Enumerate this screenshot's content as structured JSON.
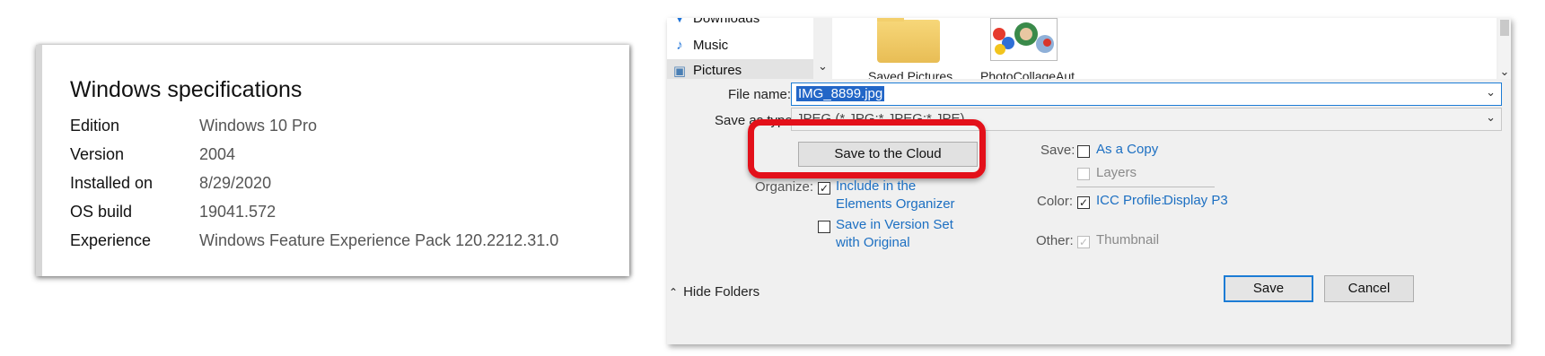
{
  "specs": {
    "title": "Windows specifications",
    "rows": [
      {
        "key": "Edition",
        "value": "Windows 10 Pro"
      },
      {
        "key": "Version",
        "value": "2004"
      },
      {
        "key": "Installed on",
        "value": "8/29/2020"
      },
      {
        "key": "OS build",
        "value": "19041.572"
      },
      {
        "key": "Experience",
        "value": "Windows Feature Experience Pack 120.2212.31.0"
      }
    ]
  },
  "dialog": {
    "nav": {
      "items": [
        {
          "label": "Downloads",
          "icon": "download-icon"
        },
        {
          "label": "Music",
          "icon": "music-note-icon"
        },
        {
          "label": "Pictures",
          "icon": "pictures-icon"
        }
      ]
    },
    "files": [
      {
        "label": "Saved Pictures",
        "icon": "folder-icon"
      },
      {
        "label": "PhotoCollageAut",
        "icon": "image-thumbnail-icon"
      }
    ],
    "file_name_label": "File name:",
    "file_name_value": "IMG_8899.jpg",
    "save_as_type_label": "Save as type:",
    "save_as_type_value": "JPEG (*.JPG;*.JPEG;*.JPE)",
    "cloud_button": "Save to the Cloud",
    "organize_label": "Organize:",
    "include_organizer_line1": "Include in the",
    "include_organizer_line2": "Elements Organizer",
    "version_set_line1": "Save in Version Set",
    "version_set_line2": "with Original",
    "save_label": "Save:",
    "as_copy": "As a Copy",
    "layers": "Layers",
    "color_label": "Color:",
    "icc_profile": "ICC Profile:",
    "icc_value": "Display P3",
    "other_label": "Other:",
    "thumbnail": "Thumbnail",
    "hide_folders": "Hide Folders",
    "save_button": "Save",
    "cancel_button": "Cancel",
    "highlight_color": "#e3101a",
    "accent_color": "#1c7cd5"
  }
}
